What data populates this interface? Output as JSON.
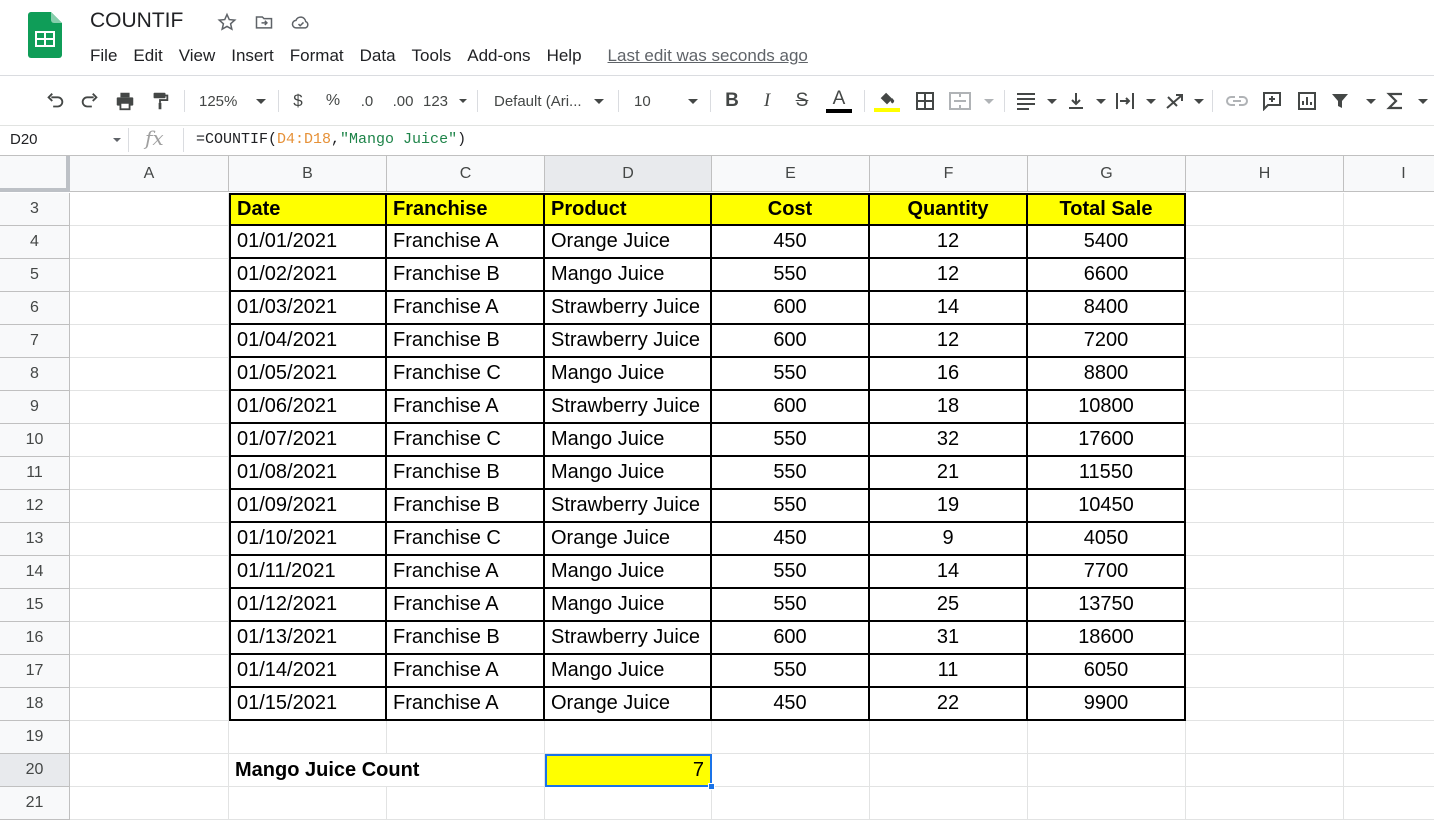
{
  "app": {
    "title": "COUNTIF",
    "last_edit": "Last edit was seconds ago"
  },
  "menu": [
    "File",
    "Edit",
    "View",
    "Insert",
    "Format",
    "Data",
    "Tools",
    "Add-ons",
    "Help"
  ],
  "toolbar": {
    "zoom": "125%",
    "currency": "$",
    "percent": "%",
    "decrease_decimal": ".0",
    "increase_decimal": ".00",
    "more_formats": "123",
    "font": "Default (Ari...",
    "font_size": "10",
    "bold": "B",
    "italic": "I",
    "strikethrough": "S",
    "text_color_letter": "A",
    "text_color": "#000000",
    "fill_color": "#ffff00"
  },
  "formula_bar": {
    "name_box": "D20",
    "fx": "fx",
    "formula_prefix": "=COUNTIF(",
    "formula_range": "D4:D18",
    "formula_comma": ",",
    "formula_string": "\"Mango Juice\"",
    "formula_suffix": ")"
  },
  "columns": [
    "A",
    "B",
    "C",
    "D",
    "E",
    "F",
    "G",
    "H",
    "I"
  ],
  "rows": [
    "3",
    "4",
    "5",
    "6",
    "7",
    "8",
    "9",
    "10",
    "11",
    "12",
    "13",
    "14",
    "15",
    "16",
    "17",
    "18",
    "19",
    "20",
    "21"
  ],
  "table": {
    "headers": [
      "Date",
      "Franchise",
      "Product",
      "Cost",
      "Quantity",
      "Total Sale"
    ],
    "rows": [
      [
        "01/01/2021",
        "Franchise A",
        "Orange Juice",
        "450",
        "12",
        "5400"
      ],
      [
        "01/02/2021",
        "Franchise B",
        "Mango Juice",
        "550",
        "12",
        "6600"
      ],
      [
        "01/03/2021",
        "Franchise A",
        "Strawberry Juice",
        "600",
        "14",
        "8400"
      ],
      [
        "01/04/2021",
        "Franchise B",
        "Strawberry Juice",
        "600",
        "12",
        "7200"
      ],
      [
        "01/05/2021",
        "Franchise C",
        "Mango Juice",
        "550",
        "16",
        "8800"
      ],
      [
        "01/06/2021",
        "Franchise A",
        "Strawberry Juice",
        "600",
        "18",
        "10800"
      ],
      [
        "01/07/2021",
        "Franchise C",
        "Mango Juice",
        "550",
        "32",
        "17600"
      ],
      [
        "01/08/2021",
        "Franchise B",
        "Mango Juice",
        "550",
        "21",
        "11550"
      ],
      [
        "01/09/2021",
        "Franchise B",
        "Strawberry Juice",
        "550",
        "19",
        "10450"
      ],
      [
        "01/10/2021",
        "Franchise C",
        "Orange Juice",
        "450",
        "9",
        "4050"
      ],
      [
        "01/11/2021",
        "Franchise A",
        "Mango Juice",
        "550",
        "14",
        "7700"
      ],
      [
        "01/12/2021",
        "Franchise A",
        "Mango Juice",
        "550",
        "25",
        "13750"
      ],
      [
        "01/13/2021",
        "Franchise B",
        "Strawberry Juice",
        "600",
        "31",
        "18600"
      ],
      [
        "01/14/2021",
        "Franchise A",
        "Mango Juice",
        "550",
        "11",
        "6050"
      ],
      [
        "01/15/2021",
        "Franchise A",
        "Orange Juice",
        "450",
        "22",
        "9900"
      ]
    ]
  },
  "summary": {
    "label": "Mango Juice Count",
    "value": "7"
  },
  "selected_cell": "D20",
  "colors": {
    "header_fill": "#ffff00",
    "selection": "#1a73e8",
    "sheets_green": "#0f9d58"
  },
  "icons": [
    "sheets-logo-icon",
    "star-icon",
    "move-to-folder-icon",
    "cloud-status-icon",
    "undo-icon",
    "redo-icon",
    "print-icon",
    "paint-format-icon",
    "fill-color-icon",
    "borders-icon",
    "merge-cells-icon",
    "align-icon",
    "valign-icon",
    "text-wrap-icon",
    "text-rotate-icon",
    "link-icon",
    "comment-icon",
    "chart-icon",
    "filter-icon",
    "functions-icon"
  ]
}
